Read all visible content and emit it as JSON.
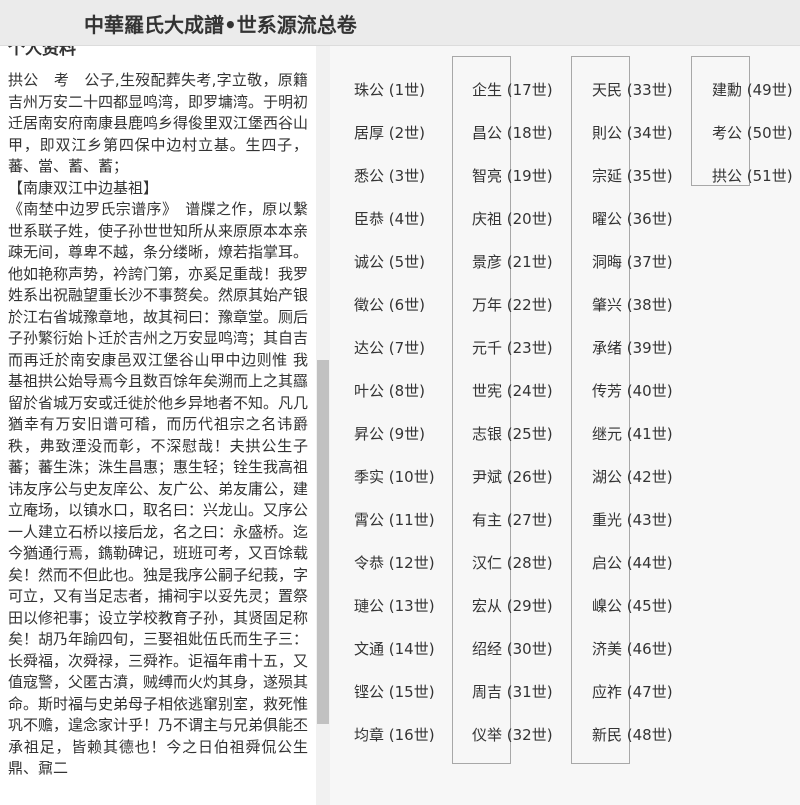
{
  "header": {
    "title": "中華羅氏大成譜•世系源流总卷"
  },
  "left": {
    "section_title": "个人资料",
    "bio": "拱公　考　公子,生歿配葬失考,字立敬，原籍吉州万安二十四都显鸣湾，即罗墉湾。于明初迁居南安府南康县鹿鸣乡得俊里双江堡西谷山甲，即双江乡第四保中边村立基。生四子，蕃、當、蓄、蓄；\n【南康双江中边基祖】\n《南埜中边罗氏宗谱序》　谱牒之作，原以繫世系联子姓，使子孙世世知所从来原原本本亲疎无间，尊卑不越，条分缕晰，燎若指掌耳。他如艳称声势，衿誇门第，亦奚足重哉！我罗姓系出祝融望重长沙不事赘矣。然原其始产银於江右省城豫章地，故其祠曰：豫章堂。厕后子孙繁衍始卜迁於吉州之万安显鸣湾；其自吉而再迁於南安康邑双江堡谷山甲中边则惟 我基祖拱公始导焉今且数百馀年矣溯而上之其羉留於省城万安或迁徙於他乡异地者不知。凡几猶幸有万安旧谱可稽，而历代祖宗之名讳爵秩，弗致湮没而彰，不深慰哉！夫拱公生子蕃；蕃生洙；洙生昌惠；惠生轻；铨生我高祖讳友序公与史友庠公、友广公、弟友庸公，建立庵场，以镇水口，取名曰：兴龙山。又序公一人建立石桥以接后龙，名之曰：永盛桥。迄今猶通行焉，鐫勒碑记，班班可考，又百馀载矣！然而不但此也。独是我序公嗣子纪莪，字可立，又有当足志者，捕祠宇以妥先灵；置祭田以修祀事；设立学校教育子孙，其贤固足称矣！胡乃年踰四旬，三娶祖妣伍氏而生子三：长舜福，次舜禄，三舜祚。讵福年甫十五，又值寇警，父匿古濆，贼缚而火灼其身，遂殒其命。斯时福与史弟母子相依逃窜别室，救死惟巩不赡，遑念家计乎！乃不谓主与兄弟俱能丕承祖足，皆赖其德也！今之日伯祖舜侃公生鼎、鼐二"
  },
  "generations": [
    {
      "name": "珠公",
      "gen": "(1世)"
    },
    {
      "name": "居厚",
      "gen": "(2世)"
    },
    {
      "name": "悉公",
      "gen": "(3世)"
    },
    {
      "name": "臣恭",
      "gen": "(4世)"
    },
    {
      "name": "诚公",
      "gen": "(5世)"
    },
    {
      "name": "徵公",
      "gen": "(6世)"
    },
    {
      "name": "达公",
      "gen": "(7世)"
    },
    {
      "name": "叶公",
      "gen": "(8世)"
    },
    {
      "name": "昇公",
      "gen": "(9世)"
    },
    {
      "name": "季实",
      "gen": "(10世)"
    },
    {
      "name": "霄公",
      "gen": "(11世)"
    },
    {
      "name": "令恭",
      "gen": "(12世)"
    },
    {
      "name": "璉公",
      "gen": "(13世)"
    },
    {
      "name": "文通",
      "gen": "(14世)"
    },
    {
      "name": "铿公",
      "gen": "(15世)"
    },
    {
      "name": "均章",
      "gen": "(16世)"
    },
    {
      "name": "企生",
      "gen": "(17世)"
    },
    {
      "name": "昌公",
      "gen": "(18世)"
    },
    {
      "name": "智亮",
      "gen": "(19世)"
    },
    {
      "name": "庆祖",
      "gen": "(20世)"
    },
    {
      "name": "景彦",
      "gen": "(21世)"
    },
    {
      "name": "万年",
      "gen": "(22世)"
    },
    {
      "name": "元千",
      "gen": "(23世)"
    },
    {
      "name": "世宪",
      "gen": "(24世)"
    },
    {
      "name": "志银",
      "gen": "(25世)"
    },
    {
      "name": "尹斌",
      "gen": "(26世)"
    },
    {
      "name": "有主",
      "gen": "(27世)"
    },
    {
      "name": "汉仁",
      "gen": "(28世)"
    },
    {
      "name": "宏从",
      "gen": "(29世)"
    },
    {
      "name": "绍经",
      "gen": "(30世)"
    },
    {
      "name": "周吉",
      "gen": "(31世)"
    },
    {
      "name": "仪举",
      "gen": "(32世)"
    },
    {
      "name": "天民",
      "gen": "(33世)"
    },
    {
      "name": "則公",
      "gen": "(34世)"
    },
    {
      "name": "宗延",
      "gen": "(35世)"
    },
    {
      "name": "曜公",
      "gen": "(36世)"
    },
    {
      "name": "洞晦",
      "gen": "(37世)"
    },
    {
      "name": "肇兴",
      "gen": "(38世)"
    },
    {
      "name": "承绪",
      "gen": "(39世)"
    },
    {
      "name": "传芳",
      "gen": "(40世)"
    },
    {
      "name": "继元",
      "gen": "(41世)"
    },
    {
      "name": "湖公",
      "gen": "(42世)"
    },
    {
      "name": "重光",
      "gen": "(43世)"
    },
    {
      "name": "启公",
      "gen": "(44世)"
    },
    {
      "name": "嵲公",
      "gen": "(45世)"
    },
    {
      "name": "济美",
      "gen": "(46世)"
    },
    {
      "name": "应祚",
      "gen": "(47世)"
    },
    {
      "name": "新民",
      "gen": "(48世)"
    },
    {
      "name": "建勳",
      "gen": "(49世)"
    },
    {
      "name": "考公",
      "gen": "(50世)"
    },
    {
      "name": "拱公",
      "gen": "(51世)"
    }
  ]
}
